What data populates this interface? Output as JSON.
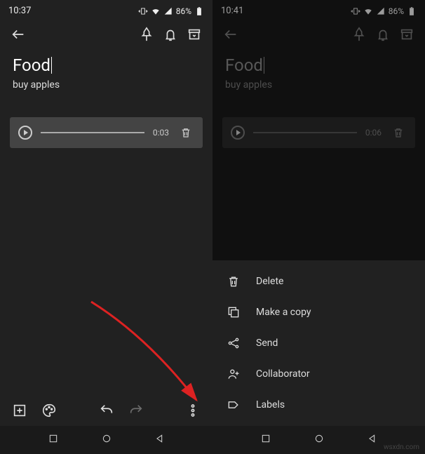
{
  "left": {
    "status": {
      "time": "10:37",
      "battery": "86%"
    },
    "note": {
      "title": "Food",
      "content": "buy apples"
    },
    "audio": {
      "duration": "0:03"
    }
  },
  "right": {
    "status": {
      "time": "10:41",
      "battery": "86%"
    },
    "note": {
      "title": "Food",
      "content": "buy apples"
    },
    "audio": {
      "duration": "0:06"
    },
    "menu": {
      "delete": "Delete",
      "copy": "Make a copy",
      "send": "Send",
      "collaborator": "Collaborator",
      "labels": "Labels"
    }
  },
  "watermark": "wsxdn.com"
}
